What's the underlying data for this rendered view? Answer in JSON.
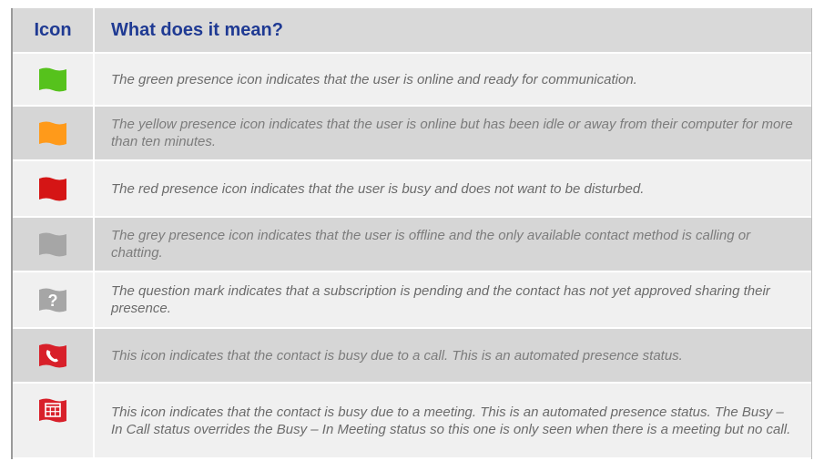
{
  "header": {
    "icon_col": "Icon",
    "meaning_col": "What does it mean?"
  },
  "colors": {
    "header_text": "#1f3a93",
    "green": "#56c21c",
    "yellow": "#ff9a1a",
    "red": "#d51515",
    "grey": "#a6a6a6",
    "icon_red": "#d8202a"
  },
  "rows": [
    {
      "icon": "green-flag-icon",
      "text": "The green presence icon indicates that the user is online and ready for communication."
    },
    {
      "icon": "yellow-flag-icon",
      "text": "The yellow presence icon indicates that the user is online but has been idle or away from their computer for more than ten minutes."
    },
    {
      "icon": "red-flag-icon",
      "text": "The red presence icon indicates that the user is busy and does not want to be disturbed."
    },
    {
      "icon": "grey-flag-icon",
      "text": "The grey presence icon indicates that the user is offline and the only available contact method is calling or chatting."
    },
    {
      "icon": "question-mark-flag-icon",
      "glyph": "?",
      "text": "The question mark indicates that a subscription is pending and the contact has not yet approved sharing their presence."
    },
    {
      "icon": "phone-flag-icon",
      "text": "This icon indicates that the contact is busy due to a call.  This is an automated presence status."
    },
    {
      "icon": "calendar-flag-icon",
      "text": "This icon indicates that the contact is busy due to a meeting.  This is an automated presence status.  The Busy – In Call status overrides the Busy – In Meeting status so this one is only seen when there is a meeting but no call."
    }
  ]
}
